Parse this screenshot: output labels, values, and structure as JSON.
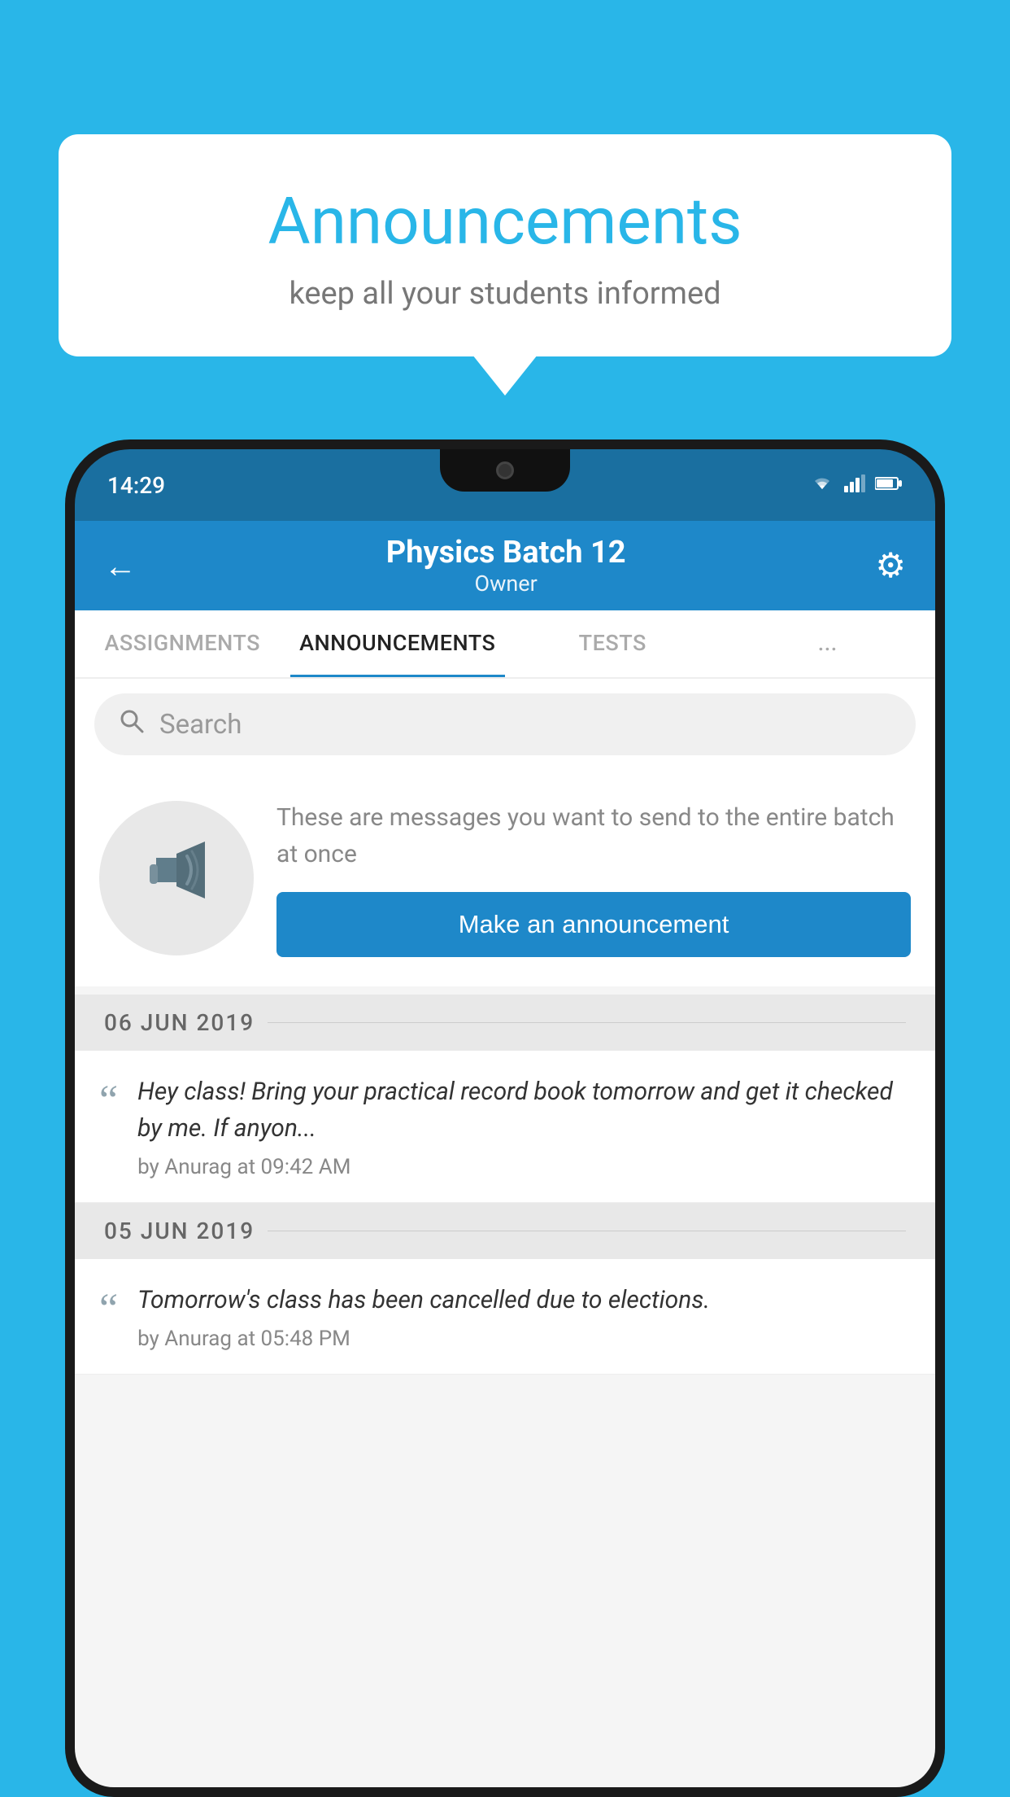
{
  "background": {
    "color": "#29b6e8"
  },
  "speech_bubble": {
    "title": "Announcements",
    "subtitle": "keep all your students informed"
  },
  "phone": {
    "status_bar": {
      "time": "14:29",
      "wifi": "▼",
      "signal": "▲",
      "battery": "▮"
    },
    "header": {
      "back_label": "←",
      "batch_name": "Physics Batch 12",
      "owner_label": "Owner",
      "settings_icon": "⚙"
    },
    "tabs": [
      {
        "label": "ASSIGNMENTS",
        "active": false
      },
      {
        "label": "ANNOUNCEMENTS",
        "active": true
      },
      {
        "label": "TESTS",
        "active": false
      },
      {
        "label": "...",
        "active": false
      }
    ],
    "search": {
      "placeholder": "Search"
    },
    "announcement_prompt": {
      "description": "These are messages you want to send to the entire batch at once",
      "button_label": "Make an announcement"
    },
    "dates": [
      {
        "date_label": "06  JUN  2019",
        "announcements": [
          {
            "message": "Hey class! Bring your practical record book tomorrow and get it checked by me. If anyon...",
            "author": "by Anurag at 09:42 AM"
          }
        ]
      },
      {
        "date_label": "05  JUN  2019",
        "announcements": [
          {
            "message": "Tomorrow's class has been cancelled due to elections.",
            "author": "by Anurag at 05:48 PM"
          }
        ]
      }
    ]
  }
}
